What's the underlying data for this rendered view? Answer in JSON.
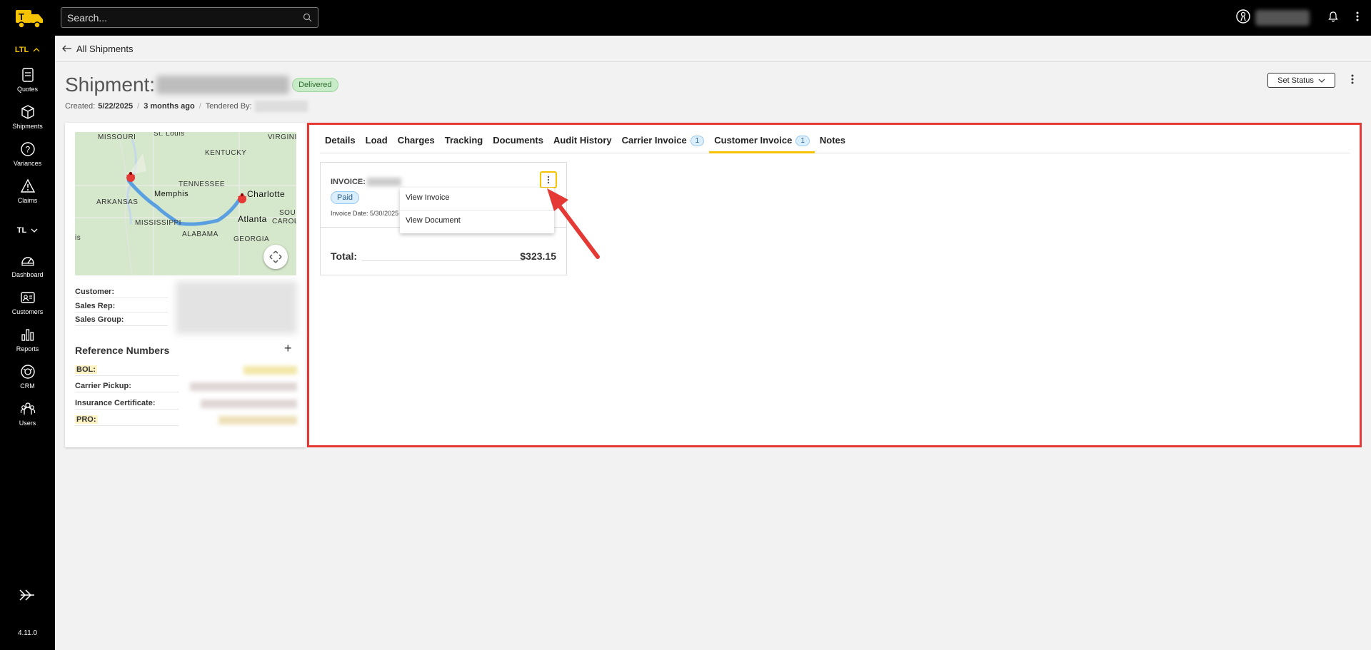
{
  "topbar": {
    "search_placeholder": "Search..."
  },
  "sidebar": {
    "ltl_label": "LTL",
    "tl_label": "TL",
    "items": [
      {
        "label": "Quotes",
        "icon": "quotes-icon"
      },
      {
        "label": "Shipments",
        "icon": "shipments-icon"
      },
      {
        "label": "Variances",
        "icon": "variances-icon"
      },
      {
        "label": "Claims",
        "icon": "claims-icon"
      },
      {
        "label": "Dashboard",
        "icon": "dashboard-icon"
      },
      {
        "label": "Customers",
        "icon": "customers-icon"
      },
      {
        "label": "Reports",
        "icon": "reports-icon"
      },
      {
        "label": "CRM",
        "icon": "crm-icon"
      },
      {
        "label": "Users",
        "icon": "users-icon"
      }
    ],
    "version": "4.11.0"
  },
  "breadcrumb": {
    "label": "All Shipments"
  },
  "shipment": {
    "title": "Shipment:",
    "status": "Delivered",
    "created_label": "Created:",
    "created_date": "5/22/2025",
    "age": "3 months ago",
    "tendered_label": "Tendered By:",
    "set_status_label": "Set Status"
  },
  "map": {
    "labels": [
      "MISSOURI",
      "St. Louis",
      "VIRGINI",
      "KENTUCKY",
      "TENNESSEE",
      "Memphis",
      "ARKANSAS",
      "Charlotte",
      "MISSISSIPPI",
      "Atlanta",
      "SOU",
      "CAROL",
      "ALABAMA",
      "GEORGIA",
      "is"
    ]
  },
  "details": {
    "customer_label": "Customer:",
    "sales_rep_label": "Sales Rep:",
    "sales_group_label": "Sales Group:"
  },
  "reference": {
    "title": "Reference Numbers",
    "rows": [
      {
        "label": "BOL:",
        "highlight": true
      },
      {
        "label": "Carrier Pickup:",
        "highlight": false
      },
      {
        "label": "Insurance Certificate:",
        "highlight": false
      },
      {
        "label": "PRO:",
        "highlight": true
      }
    ]
  },
  "tabs": [
    {
      "label": "Details"
    },
    {
      "label": "Load"
    },
    {
      "label": "Charges"
    },
    {
      "label": "Tracking"
    },
    {
      "label": "Documents"
    },
    {
      "label": "Audit History"
    },
    {
      "label": "Carrier Invoice",
      "count": "1"
    },
    {
      "label": "Customer Invoice",
      "count": "1",
      "active": true
    },
    {
      "label": "Notes"
    }
  ],
  "invoice": {
    "label": "INVOICE:",
    "status": "Paid",
    "date_label": "Invoice Date:",
    "date_value": "5/30/2025",
    "total_label": "Total:",
    "total_value": "$323.15"
  },
  "menu": {
    "items": [
      "View Invoice",
      "View Document"
    ]
  },
  "colors": {
    "accent": "#f5c300",
    "highlight_border": "#e53935",
    "delivered_bg": "#c8ecc8"
  }
}
